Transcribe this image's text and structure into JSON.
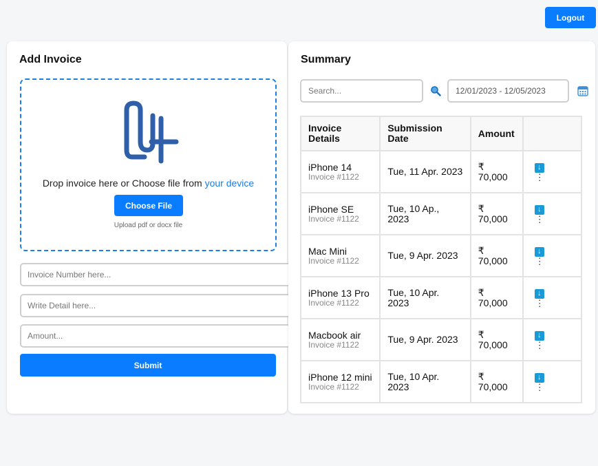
{
  "header": {
    "logout_label": "Logout"
  },
  "add_invoice": {
    "title": "Add Invoice",
    "drop_text": "Drop invoice here or Choose file from ",
    "drop_link": "your device",
    "choose_file_label": "Choose File",
    "upload_hint": "Upload pdf or docx file",
    "invoice_number_placeholder": "Invoice Number here...",
    "detail_placeholder": "Write Detail here...",
    "amount_placeholder": "Amount...",
    "submit_label": "Submit"
  },
  "summary": {
    "title": "Summary",
    "search_placeholder": "Search...",
    "date_range": "12/01/2023 - 12/05/2023",
    "columns": [
      "Invoice Details",
      "Submission Date",
      "Amount",
      ""
    ],
    "rows": [
      {
        "name": "iPhone 14",
        "invoice": "Invoice #1122",
        "date": "Tue, 11 Apr. 2023",
        "currency": "₹",
        "amount": "70,000"
      },
      {
        "name": "iPhone SE",
        "invoice": "Invoice #1122",
        "date": "Tue, 10 Ap., 2023",
        "currency": "₹",
        "amount": "70,000"
      },
      {
        "name": "Mac Mini",
        "invoice": "Invoice #1122",
        "date": "Tue, 9 Apr. 2023",
        "currency": "₹",
        "amount": "70,000"
      },
      {
        "name": "iPhone 13 Pro",
        "invoice": "Invoice #1122",
        "date": "Tue, 10 Apr. 2023",
        "currency": "₹",
        "amount": "70,000"
      },
      {
        "name": "Macbook air",
        "invoice": "Invoice #1122",
        "date": "Tue, 9 Apr. 2023",
        "currency": "₹",
        "amount": "70,000"
      },
      {
        "name": "iPhone 12 mini",
        "invoice": "Invoice #1122",
        "date": "Tue, 10 Apr. 2023",
        "currency": "₹",
        "amount": "70,000"
      }
    ],
    "row_icons": [
      "download-icon",
      "more-options-icon"
    ]
  },
  "colors": {
    "accent": "#0a7cff",
    "dashed_border": "#1a7fe0",
    "download_icon": "#1a9ad6",
    "clip_icon": "#2f5fa8"
  }
}
